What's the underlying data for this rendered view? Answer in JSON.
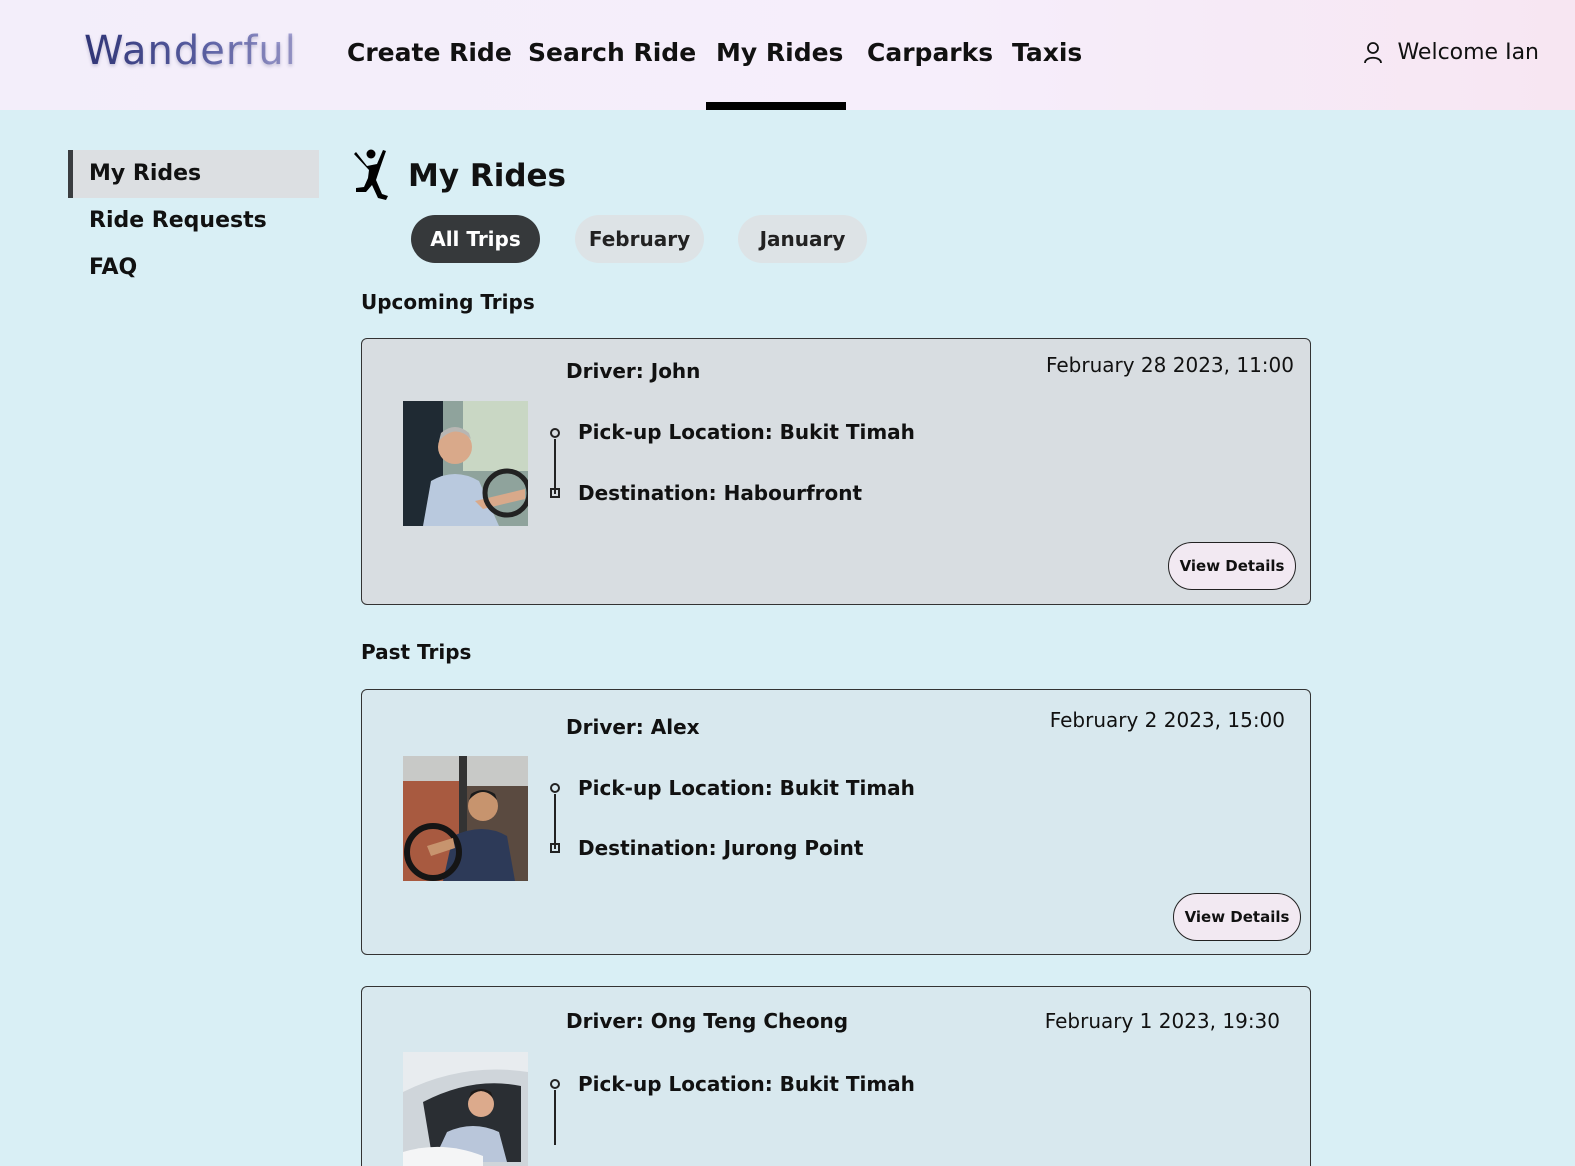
{
  "header": {
    "logo": "Wanderful",
    "nav": [
      "Create Ride",
      "Search Ride",
      "My Rides",
      "Carparks",
      "Taxis"
    ],
    "active_nav": "My Rides",
    "welcome": "Welcome Ian"
  },
  "sidebar": {
    "items": [
      {
        "label": "My Rides",
        "active": true
      },
      {
        "label": "Ride Requests",
        "active": false
      },
      {
        "label": "FAQ",
        "active": false
      }
    ]
  },
  "main": {
    "title": "My Rides",
    "filters": [
      {
        "label": "All Trips",
        "active": true
      },
      {
        "label": "February",
        "active": false
      },
      {
        "label": "January",
        "active": false
      }
    ],
    "upcoming_label": "Upcoming Trips",
    "past_label": "Past Trips",
    "upcoming": [
      {
        "driver": "Driver: John",
        "datetime": "February 28 2023, 11:00",
        "pickup": "Pick-up Location: Bukit Timah",
        "destination": "Destination: Habourfront",
        "button": "View Details"
      }
    ],
    "past": [
      {
        "driver": "Driver: Alex",
        "datetime": "February 2 2023, 15:00",
        "pickup": "Pick-up Location: Bukit Timah",
        "destination": "Destination: Jurong Point",
        "button": "View Details"
      },
      {
        "driver": "Driver: Ong Teng Cheong",
        "datetime": "February 1 2023, 19:30",
        "pickup": "Pick-up Location: Bukit Timah"
      }
    ]
  },
  "icons": {
    "user": "user-icon",
    "page": "jumping-person-icon"
  },
  "colors": {
    "page_bg": "#d9eff5",
    "active_pill": "#36393b",
    "upcoming_card": "#d8dde1",
    "past_card": "#d8e8ee",
    "button_bg": "#f2e9f2"
  }
}
